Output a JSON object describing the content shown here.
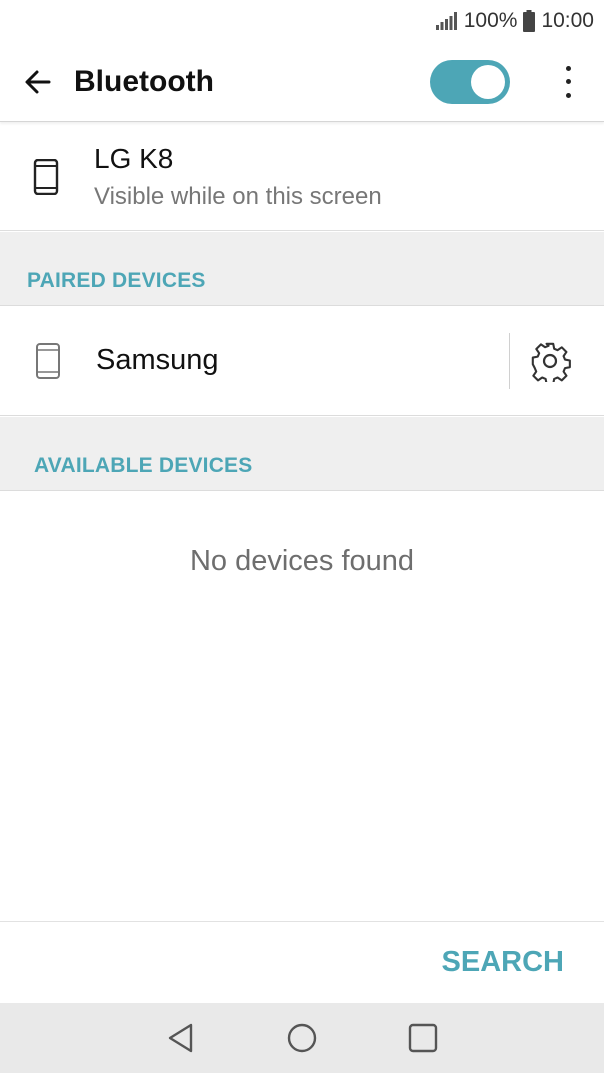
{
  "status_bar": {
    "battery_percent": "100%",
    "time": "10:00",
    "icons": [
      "signal-icon",
      "battery-icon"
    ]
  },
  "app_bar": {
    "title": "Bluetooth",
    "back_icon": "arrow-left-icon",
    "toggle_state": "on",
    "overflow_icon": "more-vert-icon"
  },
  "this_device": {
    "name": "LG K8",
    "subtitle": "Visible while on this screen",
    "icon": "phone-icon"
  },
  "paired": {
    "header": "PAIRED DEVICES",
    "devices": [
      {
        "name": "Samsung",
        "icon": "phone-icon",
        "settings_icon": "gear-icon"
      }
    ]
  },
  "available": {
    "header": "AVAILABLE DEVICES",
    "empty_text": "No devices found"
  },
  "actions": {
    "search_label": "SEARCH"
  },
  "nav": {
    "icons": [
      "back-triangle-icon",
      "home-circle-icon",
      "recents-square-icon"
    ]
  },
  "colors": {
    "accent": "#4da6b6",
    "section_bg": "#efefef",
    "nav_bg": "#e9e9e9"
  }
}
